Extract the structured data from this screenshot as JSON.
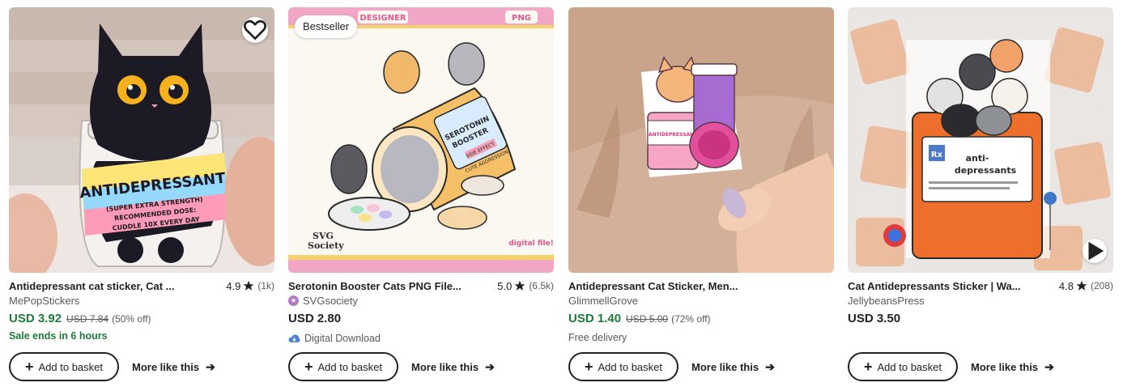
{
  "listings": [
    {
      "title": "Antidepressant cat sticker, Cat ...",
      "rating": "4.9",
      "review_count": "(1k)",
      "shop": "MePopStickers",
      "price": "USD 3.92",
      "original_price": "USD 7.84",
      "discount": "(50% off)",
      "note": "Sale ends in 6 hours",
      "add_label": "Add to basket",
      "more_label": "More like this",
      "image_text": {
        "label": "ANTIDEPRESSANT",
        "line1": "(SUPER EXTRA STRENGTH)",
        "line2": "RECOMMENDED DOSE:",
        "line3": "CUDDLE 10X EVERY DAY"
      }
    },
    {
      "badge": "Bestseller",
      "title": "Serotonin Booster Cats PNG File...",
      "rating": "5.0",
      "review_count": "(6.5k)",
      "shop": "SVGsociety",
      "price": "USD 2.80",
      "note": "Digital Download",
      "add_label": "Add to basket",
      "more_label": "More like this",
      "image_text": {
        "top_left": "DESIGNER",
        "top_right": "PNG",
        "bottle1": "SEROTONIN",
        "bottle2": "BOOSTER",
        "side": "SIDE EFFECT",
        "cute": "CUTE AGGRESSION",
        "brand1": "SVG",
        "brand2": "Society",
        "digital": "digital file!"
      }
    },
    {
      "title": "Antidepressant Cat Sticker, Men...",
      "shop": "GlimmellGrove",
      "price": "USD 1.40",
      "original_price": "USD 5.00",
      "discount": "(72% off)",
      "note": "Free delivery",
      "add_label": "Add to basket",
      "more_label": "More like this",
      "image_text": {
        "label": "ANTIDEPRESSANT"
      }
    },
    {
      "title": "Cat Antidepressants Sticker | Wa...",
      "rating": "4.8",
      "review_count": "(208)",
      "shop": "JellybeansPress",
      "price": "USD 3.50",
      "add_label": "Add to basket",
      "more_label": "More like this",
      "image_text": {
        "label1": "anti-",
        "label2": "depressants",
        "rx": "Rx"
      }
    }
  ],
  "colors": {
    "sale_green": "#1f7a3a",
    "text": "#222222",
    "muted": "#595959"
  },
  "icons": [
    "heart-icon",
    "star-icon",
    "play-icon",
    "plus-icon",
    "arrow-right-icon",
    "cloud-download-icon",
    "shop-star-icon"
  ]
}
